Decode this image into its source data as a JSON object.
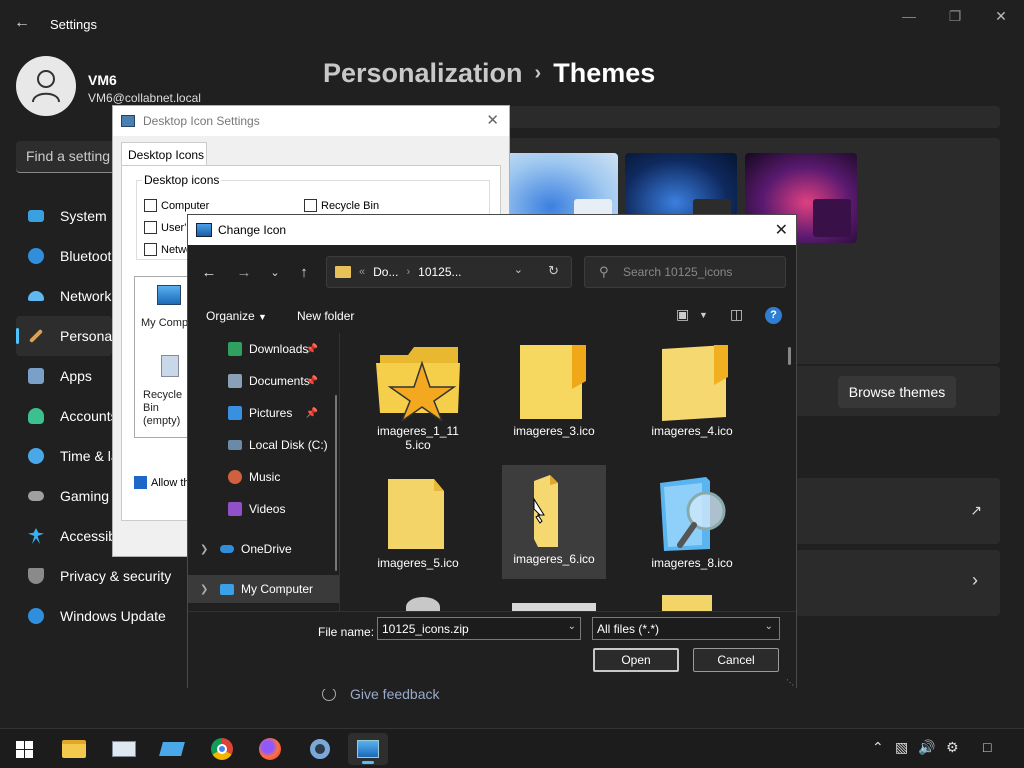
{
  "settings": {
    "app_title": "Settings",
    "profile": {
      "name": "VM6",
      "email": "VM6@collabnet.local"
    },
    "search_placeholder": "Find a setting",
    "nav": [
      {
        "label": "System",
        "icon": "monitor-icon",
        "color": "#3aa0e0"
      },
      {
        "label": "Bluetooth & devices",
        "icon": "bluetooth-icon",
        "color": "#2f8fdc"
      },
      {
        "label": "Network & internet",
        "icon": "wifi-icon",
        "color": "#5fb8f0"
      },
      {
        "label": "Personalization",
        "icon": "brush-icon",
        "color": "#e0a050"
      },
      {
        "label": "Apps",
        "icon": "apps-icon",
        "color": "#7aa0c8"
      },
      {
        "label": "Accounts",
        "icon": "account-icon",
        "color": "#3cc090"
      },
      {
        "label": "Time & language",
        "icon": "clock-icon",
        "color": "#4aa8e8"
      },
      {
        "label": "Gaming",
        "icon": "gamepad-icon",
        "color": "#a0a0a0"
      },
      {
        "label": "Accessibility",
        "icon": "accessibility-icon",
        "color": "#3ab0f0"
      },
      {
        "label": "Privacy & security",
        "icon": "shield-icon",
        "color": "#8a8a8a"
      },
      {
        "label": "Windows Update",
        "icon": "update-icon",
        "color": "#2f8fdc"
      }
    ],
    "breadcrumb": {
      "parent": "Personalization",
      "separator": "›",
      "current": "Themes"
    },
    "browse_themes_label": "Browse themes",
    "give_feedback_label": "Give feedback"
  },
  "desktop_icon_settings": {
    "title": "Desktop Icon Settings",
    "tab": "Desktop Icons",
    "group_label": "Desktop icons",
    "checkboxes": [
      {
        "label": "Computer",
        "checked": false
      },
      {
        "label": "Recycle Bin",
        "checked": false
      },
      {
        "label": "User's Files",
        "checked": false
      },
      {
        "label": "Network",
        "checked": false
      }
    ],
    "icon_labels": [
      "My Computer",
      "Recycle Bin (empty)"
    ],
    "allow_themes_label": "Allow themes to change desktop icons",
    "hidden_change_icon_label": "Change Icon"
  },
  "change_icon": {
    "title": "Change Icon",
    "address": {
      "prefix": "«",
      "part1": "Do...",
      "sep": "›",
      "part2": "10125..."
    },
    "search_placeholder": "Search 10125_icons",
    "toolbar": {
      "organize": "Organize",
      "new_folder": "New folder",
      "help": "?"
    },
    "tree": [
      {
        "label": "Downloads",
        "icon": "download-icon",
        "pinned": true
      },
      {
        "label": "Documents",
        "icon": "documents-icon",
        "pinned": true
      },
      {
        "label": "Pictures",
        "icon": "pictures-icon",
        "pinned": true
      },
      {
        "label": "Local Disk (C:)",
        "icon": "drive-icon",
        "pinned": false
      },
      {
        "label": "Music",
        "icon": "music-icon",
        "pinned": false
      },
      {
        "label": "Videos",
        "icon": "videos-icon",
        "pinned": false
      },
      {
        "label": "OneDrive",
        "icon": "onedrive-icon",
        "pinned": false
      },
      {
        "label": "My Computer",
        "icon": "computer-icon",
        "pinned": false
      }
    ],
    "files": [
      {
        "name": "imageres_1_115.ico",
        "icon": "star-folder-icon"
      },
      {
        "name": "imageres_3.ico",
        "icon": "folder-icon"
      },
      {
        "name": "imageres_4.ico",
        "icon": "folder-icon"
      },
      {
        "name": "imageres_5.ico",
        "icon": "folder-icon"
      },
      {
        "name": "imageres_6.ico",
        "icon": "folder-side-icon",
        "selected": true
      },
      {
        "name": "imageres_8.ico",
        "icon": "search-folder-icon"
      }
    ],
    "file_name_label": "File name:",
    "file_name_value": "10125_icons.zip",
    "file_type_value": "All files (*.*)",
    "open_label": "Open",
    "cancel_label": "Cancel"
  },
  "taskbar": {
    "apps": [
      "start-icon",
      "file-explorer-icon",
      "resource-monitor-icon",
      "remote-desktop-icon",
      "chrome-icon",
      "firefox-icon",
      "settings-icon",
      "desktop-icon-settings-icon"
    ],
    "tray": [
      "chevron-up-icon",
      "network-icon",
      "volume-icon",
      "gear-icon",
      "notification-icon"
    ]
  },
  "colors": {
    "accent": "#4cc2ff",
    "folder": "#f3c94d"
  }
}
